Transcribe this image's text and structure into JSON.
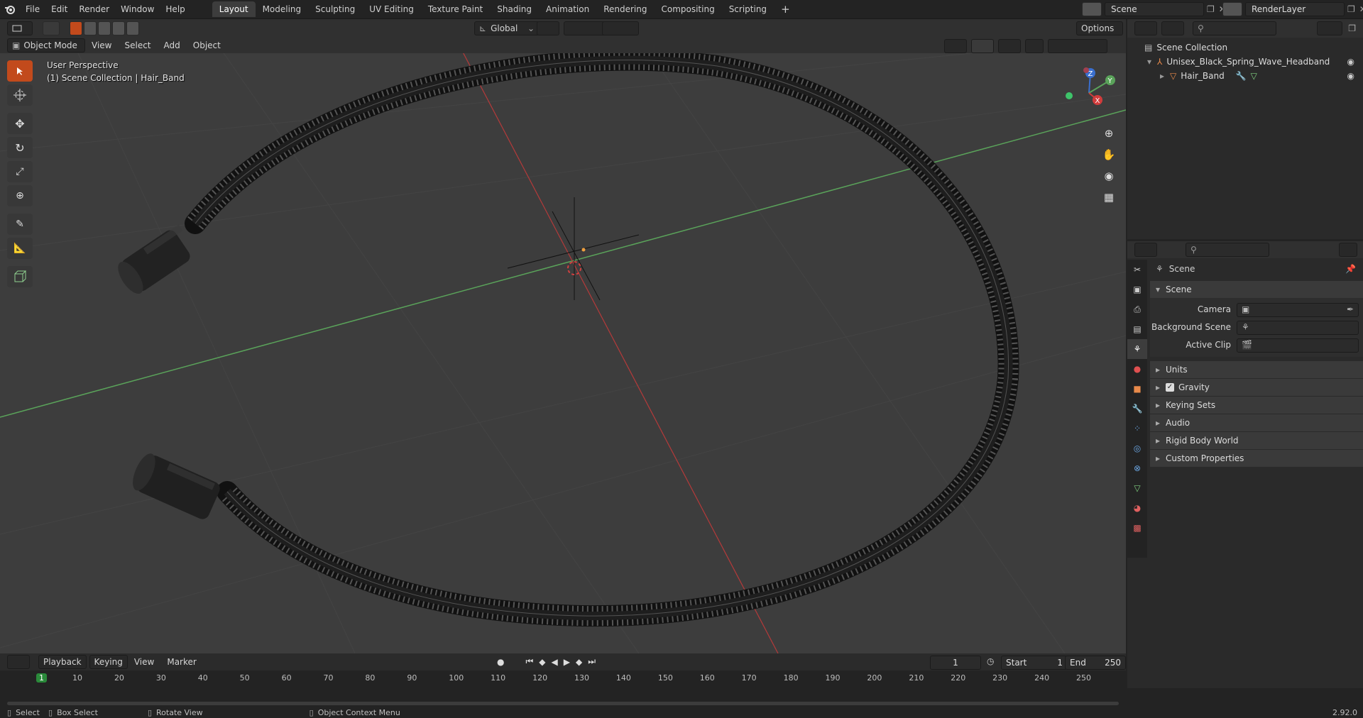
{
  "app": {
    "name": "Blender",
    "version": "2.92.0"
  },
  "menu": [
    "File",
    "Edit",
    "Render",
    "Window",
    "Help"
  ],
  "workspaces": [
    "Layout",
    "Modeling",
    "Sculpting",
    "UV Editing",
    "Texture Paint",
    "Shading",
    "Animation",
    "Rendering",
    "Compositing",
    "Scripting"
  ],
  "active_workspace": "Layout",
  "scene_name": "Scene",
  "render_layer": "RenderLayer",
  "viewport_header": {
    "mode": "Object Mode",
    "menus": [
      "View",
      "Select",
      "Add",
      "Object"
    ],
    "orientation": "Global",
    "options": "Options"
  },
  "viewport": {
    "view_name": "User Perspective",
    "collection_info": "(1) Scene Collection | Hair_Band",
    "gizmo_axes": {
      "x": "X",
      "y": "Y",
      "z": "Z"
    }
  },
  "outliner": {
    "root": "Scene Collection",
    "items": [
      {
        "label": "Unisex_Black_Spring_Wave_Headband",
        "depth": 1
      },
      {
        "label": "Hair_Band",
        "depth": 2
      }
    ]
  },
  "properties": {
    "context_title": "Scene",
    "panel_title": "Scene",
    "fields": [
      {
        "label": "Camera",
        "value": ""
      },
      {
        "label": "Background Scene",
        "value": ""
      },
      {
        "label": "Active Clip",
        "value": ""
      }
    ],
    "sections": [
      {
        "label": "Units",
        "checkbox": false
      },
      {
        "label": "Gravity",
        "checkbox": true
      },
      {
        "label": "Keying Sets",
        "checkbox": false
      },
      {
        "label": "Audio",
        "checkbox": false
      },
      {
        "label": "Rigid Body World",
        "checkbox": false
      },
      {
        "label": "Custom Properties",
        "checkbox": false
      }
    ]
  },
  "timeline": {
    "menus": [
      "Playback",
      "Keying",
      "View",
      "Marker"
    ],
    "current_frame": "1",
    "start_label": "Start",
    "start": "1",
    "end_label": "End",
    "end": "250",
    "ticks": [
      "1",
      "10",
      "20",
      "30",
      "40",
      "50",
      "60",
      "70",
      "80",
      "90",
      "100",
      "110",
      "120",
      "130",
      "140",
      "150",
      "160",
      "170",
      "180",
      "190",
      "200",
      "210",
      "220",
      "230",
      "240",
      "250"
    ]
  },
  "statusbar": {
    "select": "Select",
    "box_select": "Box Select",
    "rotate_view": "Rotate View",
    "context_menu": "Object Context Menu",
    "version": "2.92.0"
  },
  "colors": {
    "accent": "#4d6591",
    "x_axis": "#d23c3c",
    "y_axis": "#5aa35a",
    "z_axis": "#3a6fcf",
    "frame_marker": "#2a8a3a",
    "active_tool": "#c24a1c"
  }
}
